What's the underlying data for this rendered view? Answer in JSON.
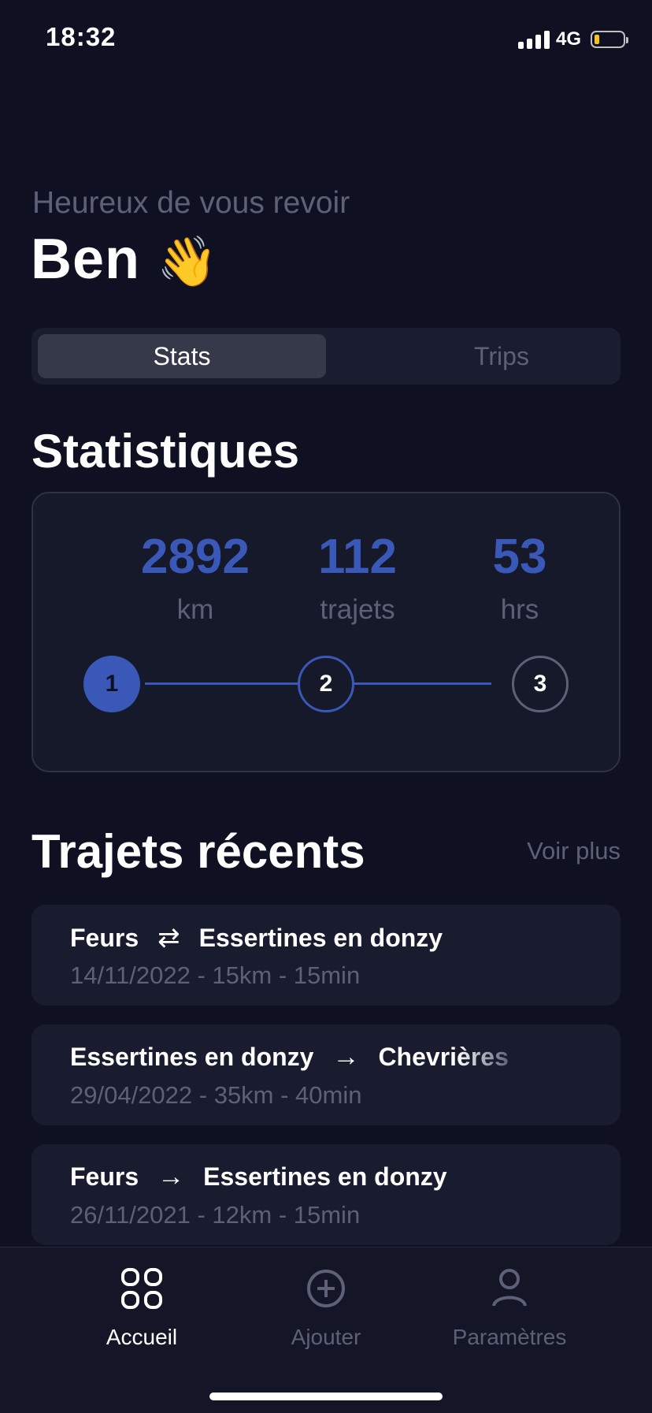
{
  "status_bar": {
    "time": "18:32",
    "network": "4G",
    "battery_level": 0.15,
    "battery_color": "#f5c518"
  },
  "greeting": {
    "subtitle": "Heureux de vous revoir",
    "name": "Ben",
    "emoji": "👋"
  },
  "segmented_control": {
    "options": [
      "Stats",
      "Trips"
    ],
    "selected": "Stats"
  },
  "stats": {
    "title": "Statistiques",
    "items": [
      {
        "value": "2892",
        "label": "km"
      },
      {
        "value": "112",
        "label": "trajets"
      },
      {
        "value": "53",
        "label": "hrs"
      }
    ],
    "steps": [
      "1",
      "2",
      "3"
    ],
    "current_step": 1
  },
  "recent_trips": {
    "title": "Trajets récents",
    "see_more": "Voir plus",
    "items": [
      {
        "from": "Feurs",
        "arrow": "⇄",
        "to": "Essertines en donzy",
        "meta": "14/11/2022 - 15km - 15min"
      },
      {
        "from": "Essertines en donzy",
        "arrow": "→",
        "to": "Chevrières",
        "meta": "29/04/2022 - 35km - 40min"
      },
      {
        "from": "Feurs",
        "arrow": "→",
        "to": "Essertines en donzy",
        "meta": "26/11/2021 - 12km - 15min"
      }
    ]
  },
  "tabbar": {
    "tabs": [
      {
        "label": "Accueil",
        "icon": "grid-icon",
        "active": true
      },
      {
        "label": "Ajouter",
        "icon": "plus-circle-icon",
        "active": false
      },
      {
        "label": "Paramètres",
        "icon": "user-icon",
        "active": false
      }
    ]
  },
  "colors": {
    "background": "#0f1123",
    "accent": "#3a58b8",
    "muted": "#5d6178"
  }
}
